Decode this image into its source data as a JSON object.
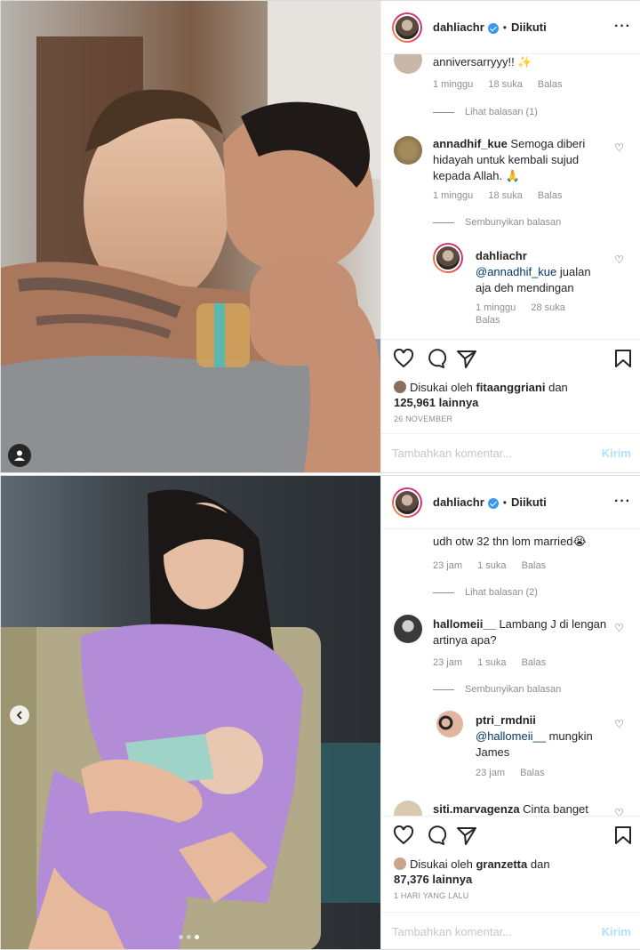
{
  "post1": {
    "username": "dahliachr",
    "follow_status": "Diikuti",
    "comments": {
      "partial_text": "anniversarryyy!! ✨",
      "partial_meta": [
        "1 minggu",
        "18 suka",
        "Balas"
      ],
      "view_replies": "Lihat balasan (1)",
      "c2_user": "annadhif_kue",
      "c2_text": "Semoga diberi hidayah untuk kembali sujud kepada Allah. 🙏",
      "c2_meta": [
        "1 minggu",
        "18 suka",
        "Balas"
      ],
      "hide_replies": "Sembunyikan balasan",
      "reply_user": "dahliachr",
      "reply_mention": "@annadhif_kue",
      "reply_text": "jualan aja deh mendingan",
      "reply_meta": [
        "1 minggu",
        "28 suka",
        "Balas"
      ]
    },
    "liked_prefix": "Disukai oleh",
    "liked_user": "fitaanggriani",
    "liked_and": "dan",
    "likes_count": "125,961 lainnya",
    "date": "26 NOVEMBER",
    "add_comment_placeholder": "Tambahkan komentar...",
    "send_label": "Kirim"
  },
  "post2": {
    "username": "dahliachr",
    "follow_status": "Diikuti",
    "comments": {
      "partial_text": "udh otw 32 thn lom married😭",
      "partial_meta": [
        "23 jam",
        "1 suka",
        "Balas"
      ],
      "view_replies": "Lihat balasan (2)",
      "c2_user": "hallomeii__",
      "c2_text": "Lambang J di lengan artinya apa?",
      "c2_meta": [
        "23 jam",
        "1 suka",
        "Balas"
      ],
      "hide_replies": "Sembunyikan balasan",
      "reply_user": "ptri_rmdnii",
      "reply_mention": "@hallomeii__",
      "reply_text": "mungkin James",
      "reply_meta": [
        "23 jam",
        "Balas"
      ],
      "c4_user": "siti.marvagenza",
      "c4_text": "Cinta banget"
    },
    "liked_prefix": "Disukai oleh",
    "liked_user": "granzetta",
    "liked_and": "dan",
    "likes_count": "87,376 lainnya",
    "date": "1 HARI YANG LALU",
    "add_comment_placeholder": "Tambahkan komentar...",
    "send_label": "Kirim"
  },
  "icons": [
    "heart-icon",
    "comment-icon",
    "share-icon",
    "bookmark-icon",
    "more-icon",
    "verified-icon",
    "user-tag-icon",
    "prev-arrow-icon"
  ],
  "colors": {
    "link": "#00376b",
    "verified": "#3897f0",
    "send_disabled": "#b2dffc",
    "meta": "#8e8e8e"
  }
}
